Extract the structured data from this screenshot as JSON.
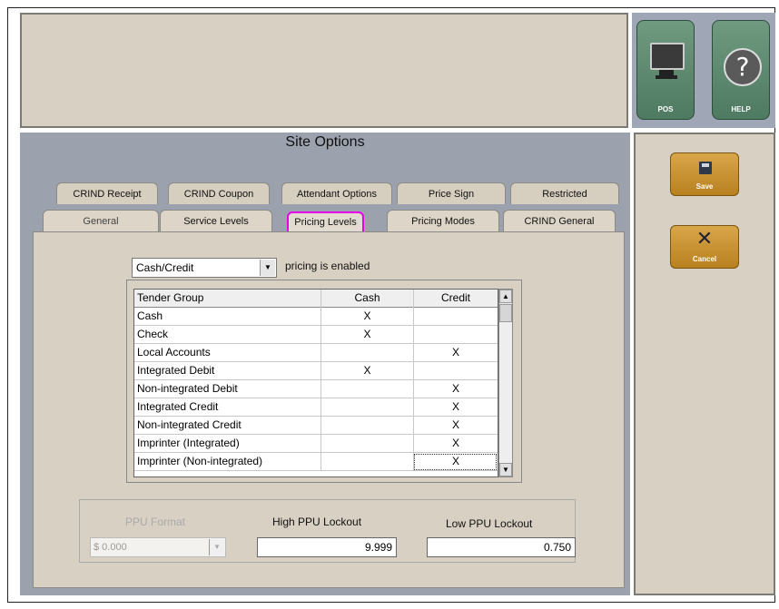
{
  "header": {
    "message": ""
  },
  "right_buttons": {
    "pos_label": "POS",
    "help_label": "HELP",
    "help_glyph": "?"
  },
  "actions": {
    "save_label": "Save",
    "cancel_label": "Cancel",
    "cancel_glyph": "✕"
  },
  "title": "Site Options",
  "tabs_back": [
    "CRIND Receipt",
    "CRIND Coupon",
    "Attendant Options",
    "Price Sign",
    "Restricted"
  ],
  "tabs_front": [
    "General",
    "Service Levels",
    "Pricing Levels",
    "Pricing Modes",
    "CRIND General"
  ],
  "active_tab": "Pricing Levels",
  "pricing": {
    "mode_value": "Cash/Credit",
    "enabled_text": "pricing is enabled",
    "dropdown_glyph": "▼"
  },
  "table": {
    "headers": [
      "Tender Group",
      "Cash",
      "Credit"
    ],
    "rows": [
      {
        "group": "Cash",
        "cash": "X",
        "credit": ""
      },
      {
        "group": "Check",
        "cash": "X",
        "credit": ""
      },
      {
        "group": "Local Accounts",
        "cash": "",
        "credit": "X"
      },
      {
        "group": "Integrated Debit",
        "cash": "X",
        "credit": ""
      },
      {
        "group": "Non-integrated Debit",
        "cash": "",
        "credit": "X"
      },
      {
        "group": "Integrated Credit",
        "cash": "",
        "credit": "X"
      },
      {
        "group": "Non-integrated Credit",
        "cash": "",
        "credit": "X"
      },
      {
        "group": "Imprinter (Integrated)",
        "cash": "",
        "credit": "X"
      },
      {
        "group": "Imprinter (Non-integrated)",
        "cash": "",
        "credit": "X"
      }
    ],
    "scroll_up_glyph": "▲",
    "scroll_down_glyph": "▼"
  },
  "ppu": {
    "format_label": "PPU Format",
    "format_value": "$ 0.000",
    "high_label": "High PPU Lockout",
    "high_value": "9.999",
    "low_label": "Low PPU Lockout",
    "low_value": "0.750"
  },
  "colors": {
    "background": "#9ba1ad",
    "panel": "#d8d0c3",
    "active_tab_outline": "#e500e5",
    "pos_help_button": "#5f8a71",
    "save_cancel_button": "#c8922f"
  }
}
